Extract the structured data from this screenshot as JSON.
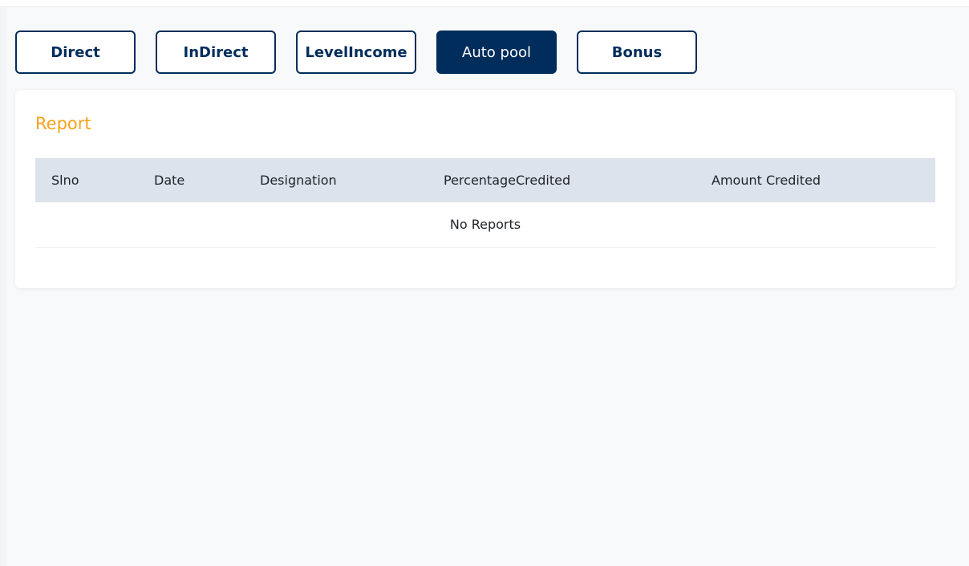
{
  "tabs": [
    {
      "label": "Direct"
    },
    {
      "label": "InDirect"
    },
    {
      "label": "LevelIncome"
    },
    {
      "label": "Auto pool"
    },
    {
      "label": "Bonus"
    }
  ],
  "active_tab": "Auto pool",
  "report": {
    "title": "Report",
    "columns": [
      "Slno",
      "Date",
      "Designation",
      "PercentageCredited",
      "Amount Credited"
    ],
    "empty_message": "No Reports"
  },
  "colors": {
    "primary": "#002d5b",
    "accent": "#f7a21b",
    "table_header_bg": "#dce3ed",
    "page_bg": "#f8f9fa"
  }
}
